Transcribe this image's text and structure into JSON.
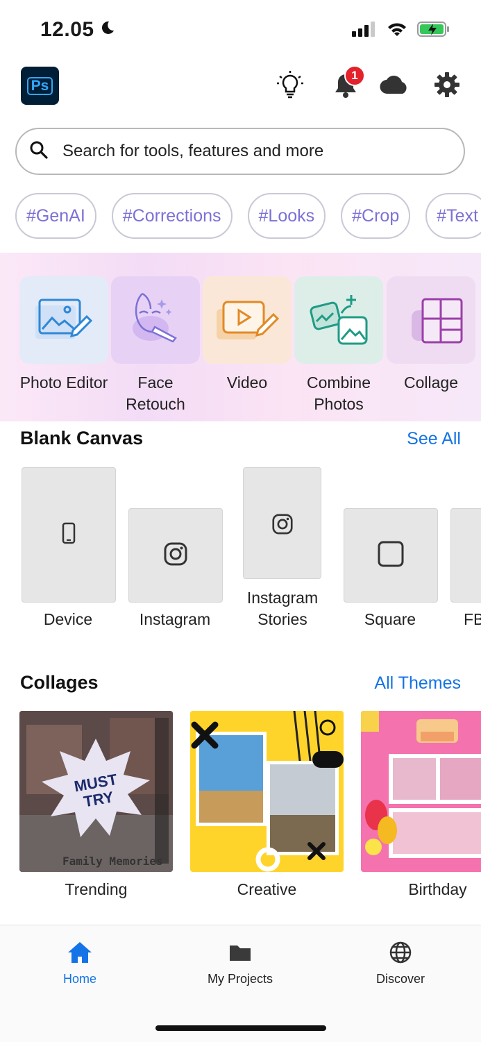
{
  "status_bar": {
    "time": "12.05",
    "mode_icon": "moon-icon",
    "icons": [
      "signal-icon",
      "wifi-icon",
      "battery-charging-icon"
    ]
  },
  "header": {
    "app_logo": "Ps",
    "notifications_count": "1",
    "icons": [
      "lightbulb-icon",
      "bell-icon",
      "cloud-icon",
      "gear-icon"
    ]
  },
  "search": {
    "placeholder": "Search for tools, features and more"
  },
  "chips": [
    "#GenAI",
    "#Corrections",
    "#Looks",
    "#Crop",
    "#Text"
  ],
  "tools": [
    {
      "label": "Photo Editor",
      "icon": "photo-edit-icon"
    },
    {
      "label": "Face Retouch",
      "icon": "face-retouch-icon"
    },
    {
      "label": "Video",
      "icon": "video-edit-icon"
    },
    {
      "label": "Combine Photos",
      "icon": "combine-photos-icon"
    },
    {
      "label": "Collage",
      "icon": "collage-grid-icon"
    }
  ],
  "blank_canvas": {
    "title": "Blank Canvas",
    "see_all": "See All",
    "items": [
      {
        "label": "Device",
        "icon": "phone-icon"
      },
      {
        "label": "Instagram",
        "icon": "instagram-icon"
      },
      {
        "label": "Instagram Stories",
        "icon": "instagram-icon"
      },
      {
        "label": "Square",
        "icon": "square-icon"
      },
      {
        "label": "FB",
        "icon": ""
      }
    ]
  },
  "collages": {
    "title": "Collages",
    "all_themes": "All Themes",
    "items": [
      {
        "label": "Trending",
        "badge_text": "MUST TRY",
        "caption": "Family Memories"
      },
      {
        "label": "Creative"
      },
      {
        "label": "Birthday"
      }
    ]
  },
  "bottom_nav": {
    "items": [
      {
        "label": "Home",
        "icon": "home-icon",
        "active": true
      },
      {
        "label": "My Projects",
        "icon": "folder-icon",
        "active": false
      },
      {
        "label": "Discover",
        "icon": "globe-icon",
        "active": false
      }
    ],
    "active_color": "#1473e6"
  },
  "colors": {
    "accent": "#1473e6",
    "chip_text": "#7b71d6",
    "badge": "#e3222b",
    "ps_blue": "#31a8ff",
    "ps_bg": "#001e36"
  }
}
